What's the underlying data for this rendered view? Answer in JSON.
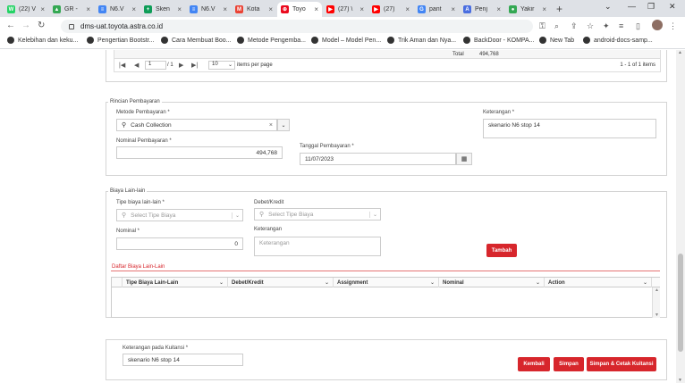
{
  "browser": {
    "tabs": [
      {
        "label": "(22) V",
        "color": "#25d366",
        "glyph": "W"
      },
      {
        "label": "GR -",
        "color": "#34a853",
        "glyph": "▲"
      },
      {
        "label": "N6.V",
        "color": "#4285f4",
        "glyph": "≡"
      },
      {
        "label": "Sken",
        "color": "#0f9d58",
        "glyph": "+"
      },
      {
        "label": "N6.V",
        "color": "#4285f4",
        "glyph": "≡"
      },
      {
        "label": "Kota",
        "color": "#ea4335",
        "glyph": "M"
      },
      {
        "label": "Toyo",
        "color": "#eb0a1e",
        "glyph": "⊕"
      },
      {
        "label": "(27) \\",
        "color": "#ff0000",
        "glyph": "▶"
      },
      {
        "label": "(27)",
        "color": "#ff0000",
        "glyph": "▶"
      },
      {
        "label": "pant",
        "color": "#4285f4",
        "glyph": "G"
      },
      {
        "label": "Penj",
        "color": "#4a6ee0",
        "glyph": "A"
      },
      {
        "label": "Yakir",
        "color": "#34a853",
        "glyph": "●"
      }
    ],
    "active_tab_index": 6,
    "url": "dms-uat.toyota.astra.co.id",
    "bookmarks": [
      "Kelebihan dan keku...",
      "Pengertian Bootstr...",
      "Cara Membuat Boo...",
      "Metode Pengemba...",
      "Model – Model Pen...",
      "Trik Aman dan Nya...",
      "BackDoor - KOMPA...",
      "New Tab",
      "android-docs-samp..."
    ]
  },
  "top_grid": {
    "total_label": "Total",
    "total_value": "494,768",
    "page_value": "1",
    "page_of": "/ 1",
    "per_page_value": "10",
    "per_page_label": "items per page",
    "range_text": "1 - 1 of 1 items"
  },
  "rincian": {
    "legend": "Rincian Pembayaran",
    "metode_label": "Metode Pembayaran *",
    "metode_value": "Cash Collection",
    "nominal_label": "Nominal Pembayaran *",
    "nominal_value": "494,768",
    "tanggal_label": "Tanggal Pembayaran *",
    "tanggal_value": "11/07/2023",
    "keterangan_label": "Keterangan *",
    "keterangan_value": "skenario N6 stop 14"
  },
  "biaya": {
    "legend": "Biaya Lain-lain",
    "tipe_label": "Tipe biaya lain-lain *",
    "tipe_placeholder": "Select Tipe Biaya",
    "debet_label": "Debet/Kredit",
    "debet_placeholder": "Select Tipe Biaya",
    "nominal_label": "Nominal *",
    "nominal_value": "0",
    "keterangan_label": "Keterangan",
    "keterangan_placeholder": "Keterangan",
    "tambah_label": "Tambah",
    "daftar_title": "Daftar Biaya Lain-Lain",
    "columns": [
      "Tipe Biaya Lain-Lain",
      "Debet/Kredit",
      "Assignment",
      "Nominal",
      "Action"
    ]
  },
  "footer": {
    "kuitansi_label": "Keterangan pada Kuitansi *",
    "kuitansi_value": "skenario N6 stop 14",
    "kembali_label": "Kembali",
    "simpan_label": "Simpan",
    "simpan_cetak_label": "Simpan & Cetak Kuitansi"
  }
}
